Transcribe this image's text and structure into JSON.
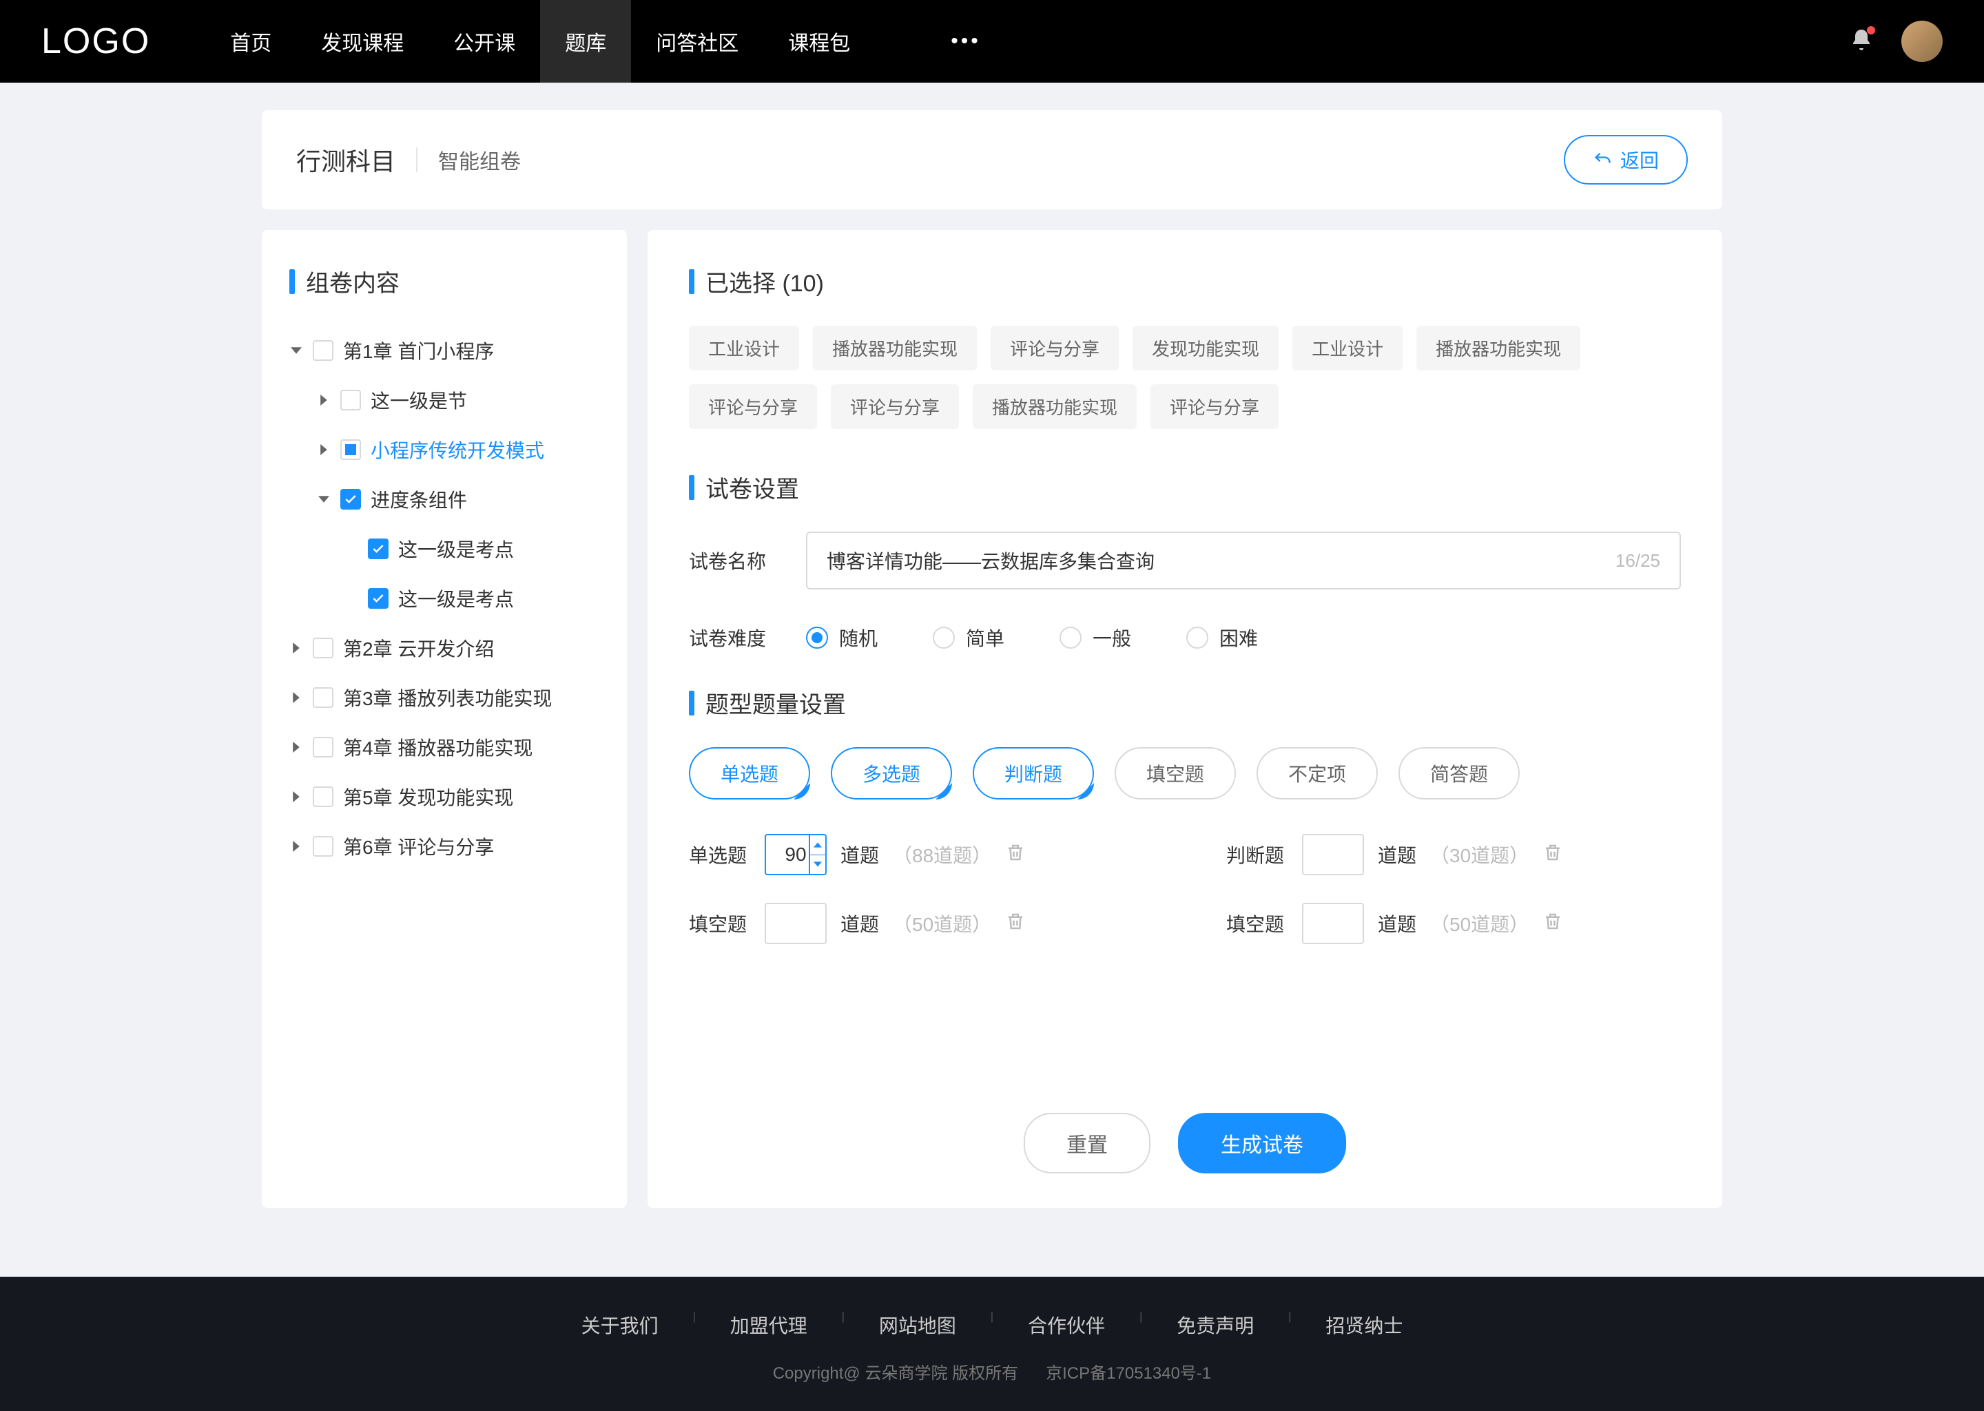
{
  "header": {
    "logo": "LOGO",
    "nav": [
      "首页",
      "发现课程",
      "公开课",
      "题库",
      "问答社区",
      "课程包"
    ],
    "nav_active_index": 3
  },
  "page": {
    "title": "行测科目",
    "subtitle": "智能组卷",
    "back_label": "返回"
  },
  "sidebar": {
    "title": "组卷内容",
    "tree": [
      {
        "label": "第1章 首门小程序",
        "expanded": true,
        "checked": false,
        "children": [
          {
            "label": "这一级是节",
            "expanded": false,
            "checked": false,
            "has_children": true
          },
          {
            "label": "小程序传统开发模式",
            "expanded": false,
            "checked": "indeterminate",
            "has_children": true,
            "selected": true
          },
          {
            "label": "进度条组件",
            "expanded": true,
            "checked": true,
            "children": [
              {
                "label": "这一级是考点",
                "checked": true
              },
              {
                "label": "这一级是考点",
                "checked": true
              }
            ]
          }
        ]
      },
      {
        "label": "第2章 云开发介绍",
        "expanded": false,
        "checked": false,
        "has_children": true
      },
      {
        "label": "第3章 播放列表功能实现",
        "expanded": false,
        "checked": false,
        "has_children": true
      },
      {
        "label": "第4章 播放器功能实现",
        "expanded": false,
        "checked": false,
        "has_children": true
      },
      {
        "label": "第5章 发现功能实现",
        "expanded": false,
        "checked": false,
        "has_children": true
      },
      {
        "label": "第6章 评论与分享",
        "expanded": false,
        "checked": false,
        "has_children": true
      }
    ]
  },
  "selected": {
    "title_prefix": "已选择",
    "count": 10,
    "tags": [
      "工业设计",
      "播放器功能实现",
      "评论与分享",
      "发现功能实现",
      "工业设计",
      "播放器功能实现",
      "评论与分享",
      "评论与分享",
      "播放器功能实现",
      "评论与分享"
    ]
  },
  "paper_settings": {
    "title": "试卷设置",
    "name_label": "试卷名称",
    "name_value": "博客详情功能——云数据库多集合查询",
    "name_counter": "16/25",
    "difficulty_label": "试卷难度",
    "difficulty_options": [
      "随机",
      "简单",
      "一般",
      "困难"
    ],
    "difficulty_selected": 0
  },
  "type_settings": {
    "title": "题型题量设置",
    "types": [
      {
        "label": "单选题",
        "selected": true
      },
      {
        "label": "多选题",
        "selected": true
      },
      {
        "label": "判断题",
        "selected": true
      },
      {
        "label": "填空题",
        "selected": false
      },
      {
        "label": "不定项",
        "selected": false
      },
      {
        "label": "简答题",
        "selected": false
      }
    ],
    "quantities": [
      {
        "label": "单选题",
        "value": "90",
        "unit": "道题",
        "hint": "（88道题）",
        "active": true
      },
      {
        "label": "判断题",
        "value": "",
        "unit": "道题",
        "hint": "（30道题）",
        "active": false
      },
      {
        "label": "填空题",
        "value": "",
        "unit": "道题",
        "hint": "（50道题）",
        "active": false
      },
      {
        "label": "填空题",
        "value": "",
        "unit": "道题",
        "hint": "（50道题）",
        "active": false
      }
    ]
  },
  "actions": {
    "reset": "重置",
    "generate": "生成试卷"
  },
  "footer": {
    "links": [
      "关于我们",
      "加盟代理",
      "网站地图",
      "合作伙伴",
      "免责声明",
      "招贤纳士"
    ],
    "copyright": "Copyright@ 云朵商学院   版权所有",
    "icp": "京ICP备17051340号-1"
  }
}
